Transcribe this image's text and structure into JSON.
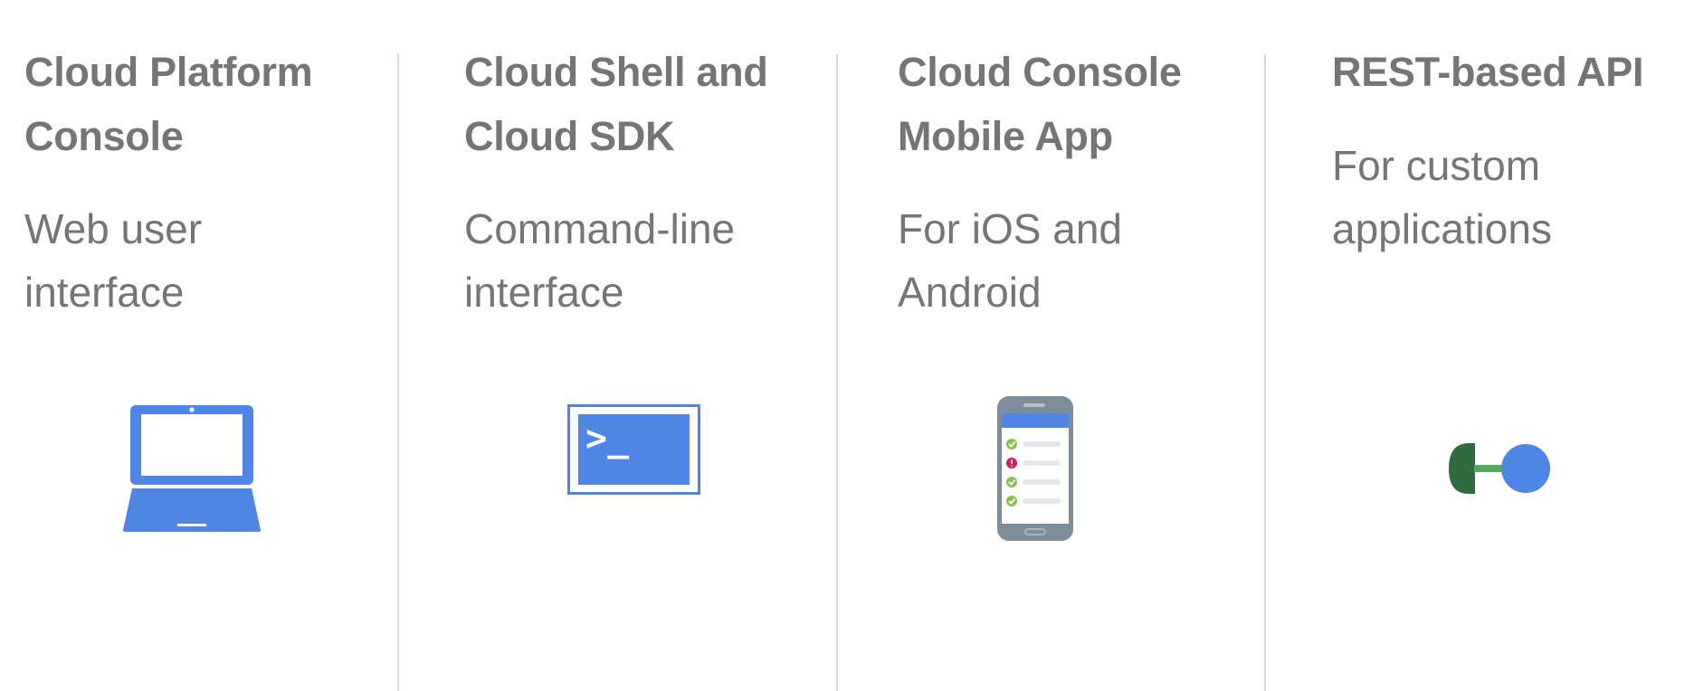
{
  "features": [
    {
      "title_line1": "Cloud Platform",
      "title_line2": "Console",
      "desc_line1": "Web user",
      "desc_line2": "interface",
      "icon": "laptop-icon"
    },
    {
      "title_line1": "Cloud Shell and",
      "title_line2": "Cloud SDK",
      "desc_line1": "Command-line",
      "desc_line2": "interface",
      "icon": "terminal-icon",
      "icon_text": ">_"
    },
    {
      "title_line1": "Cloud Console",
      "title_line2": "Mobile App",
      "desc_line1": "For iOS and",
      "desc_line2": "Android",
      "icon": "mobile-phone-icon"
    },
    {
      "title_line1": "REST-based API",
      "desc_line1": "For custom",
      "desc_line2": "applications",
      "icon": "api-connector-icon"
    }
  ],
  "colors": {
    "text": "#757575",
    "divider": "#dadada",
    "blue": "#4f86e6",
    "phone_gray": "#7d8e9a",
    "dark_green": "#2e6b3e",
    "green": "#55a860",
    "check_green": "#8bc34a",
    "alert_red": "#d81b60"
  }
}
